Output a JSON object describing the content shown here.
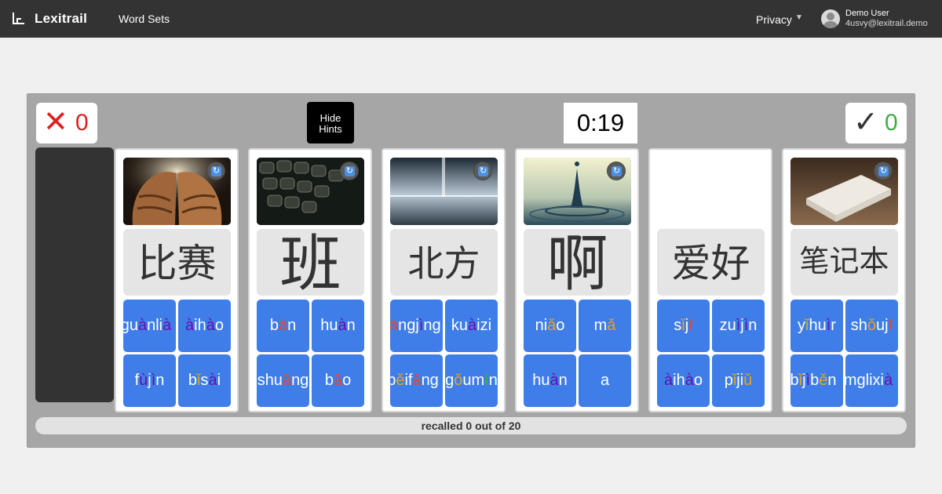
{
  "nav": {
    "app_name": "Lexitrail",
    "logo_icon": "bar-chart-icon",
    "word_sets_link": "Word Sets",
    "privacy_menu": "Privacy",
    "privacy_caret": "▼",
    "user_name": "Demo User",
    "user_email": "4usvy@lexitrail.demo"
  },
  "game": {
    "wrong_symbol": "✕",
    "wrong_count": "0",
    "correct_symbol": "✓",
    "correct_count": "0",
    "hide_hints_label": "Hide Hints",
    "timer": "0:19",
    "progress_text": "recalled 0 out of 20",
    "refresh_icon": "refresh-icon"
  },
  "cards": [
    {
      "hanzi": "比赛",
      "image": "walnut",
      "options": [
        "guànlià",
        "àihào",
        "fùjìn",
        "bǐsài"
      ]
    },
    {
      "hanzi": "班",
      "image": "keyboard",
      "options": [
        "bān",
        "huàn",
        "shuāng",
        "bāo"
      ]
    },
    {
      "hanzi": "北方",
      "image": "horizon",
      "options": [
        "fāngjìng",
        "kuàizi",
        "běifāng",
        "gǒumín"
      ]
    },
    {
      "hanzi": "啊",
      "image": "water-drop",
      "options": [
        "niǎo",
        "mǎ",
        "huàn",
        "a"
      ]
    },
    {
      "hanzi": "爱好",
      "image": "",
      "options": [
        "sǐjī",
        "zuìjìn",
        "àihào",
        "pǐjiǔ"
      ]
    },
    {
      "hanzi": "笔记本",
      "image": "eraser",
      "options": [
        "yǐhuìr",
        "shǒujī",
        "bǐjìběn",
        "mglixià"
      ]
    }
  ],
  "colors": {
    "tone1": "#e8452c",
    "tone2": "#3cb043",
    "tone3": "#e8a21a",
    "tone4": "#6a0dad",
    "option_bg": "#3f7ee8",
    "nav_bg": "#333333"
  }
}
